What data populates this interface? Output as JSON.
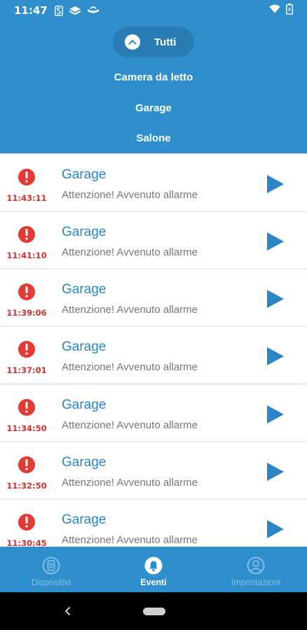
{
  "status_bar": {
    "time": "11:47",
    "icons": [
      "s-notification-icon",
      "layers-icon",
      "hat-icon",
      "wifi-icon",
      "battery-icon"
    ]
  },
  "filter": {
    "selected": "Tutti",
    "options": [
      "Camera da letto",
      "Garage",
      "Salone"
    ]
  },
  "events": [
    {
      "title": "Garage",
      "message": "Attenzione! Avvenuto allarme",
      "time": "11:43:11"
    },
    {
      "title": "Garage",
      "message": "Attenzione! Avvenuto allarme",
      "time": "11:41:10"
    },
    {
      "title": "Garage",
      "message": "Attenzione! Avvenuto allarme",
      "time": "11:39:06"
    },
    {
      "title": "Garage",
      "message": "Attenzione! Avvenuto allarme",
      "time": "11:37:01"
    },
    {
      "title": "Garage",
      "message": "Attenzione! Avvenuto allarme",
      "time": "11:34:50"
    },
    {
      "title": "Garage",
      "message": "Attenzione! Avvenuto allarme",
      "time": "11:32:50"
    },
    {
      "title": "Garage",
      "message": "Attenzione! Avvenuto allarme",
      "time": "11:30:45"
    }
  ],
  "bottom_nav": {
    "tabs": [
      {
        "label": "Dispositivi",
        "icon": "devices-icon",
        "active": false
      },
      {
        "label": "Eventi",
        "icon": "bell-icon",
        "active": true
      },
      {
        "label": "Impostazioni",
        "icon": "user-icon",
        "active": false
      }
    ]
  },
  "colors": {
    "primary": "#2f8fcd",
    "alert": "#e53935",
    "time_red": "#d32f2f",
    "title_blue": "#2a86c5"
  }
}
